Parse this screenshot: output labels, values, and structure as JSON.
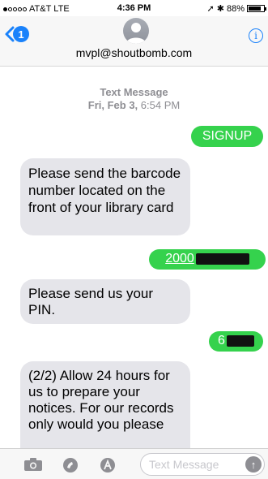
{
  "status": {
    "carrier": "AT&T",
    "network": "LTE",
    "time": "4:36 PM",
    "battery": "88%"
  },
  "header": {
    "back_count": "1",
    "contact": "mvpl@shoutbomb.com",
    "info_icon": "info-icon"
  },
  "conversation": {
    "type_label": "Text Message",
    "date_bold": "Fri, Feb 3,",
    "time": "6:54 PM",
    "messages": [
      {
        "dir": "sent",
        "text": "SIGNUP"
      },
      {
        "dir": "received",
        "text": "Please send the barcode number located on the front of your library card"
      },
      {
        "dir": "sent",
        "text": "2000"
      },
      {
        "dir": "received",
        "text": "Please send us your PIN."
      },
      {
        "dir": "sent",
        "text": "6"
      },
      {
        "dir": "received",
        "text": "(2/2) Allow 24 hours for us to prepare your notices. For our records only would you please"
      }
    ]
  },
  "input": {
    "placeholder": "Text Message"
  },
  "colors": {
    "sent_bubble": "#35d24d",
    "received_bubble": "#e5e5ea",
    "accent": "#1a82fb"
  }
}
